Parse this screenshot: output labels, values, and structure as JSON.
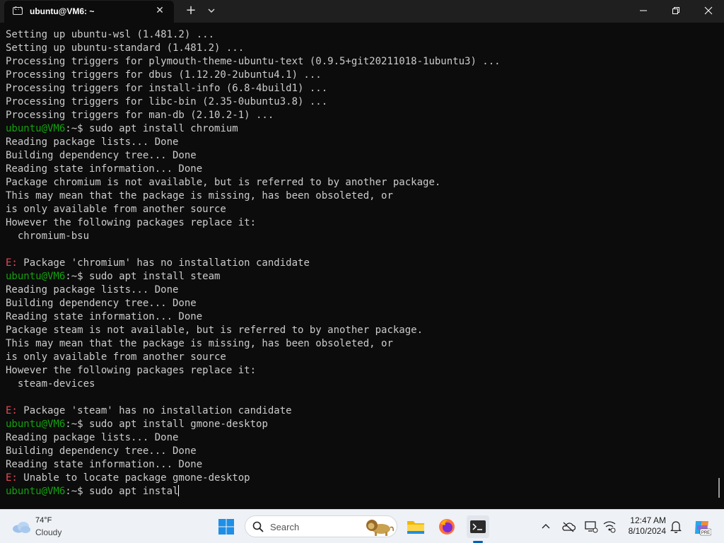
{
  "window": {
    "tab_title": "ubuntu@VM6: ~",
    "tab_icon_glyph": "C:\\"
  },
  "terminal": {
    "lines": [
      [
        {
          "c": "out",
          "t": "Setting up ubuntu-wsl (1.481.2) ..."
        }
      ],
      [
        {
          "c": "out",
          "t": "Setting up ubuntu-standard (1.481.2) ..."
        }
      ],
      [
        {
          "c": "out",
          "t": "Processing triggers for plymouth-theme-ubuntu-text (0.9.5+git20211018-1ubuntu3) ..."
        }
      ],
      [
        {
          "c": "out",
          "t": "Processing triggers for dbus (1.12.20-2ubuntu4.1) ..."
        }
      ],
      [
        {
          "c": "out",
          "t": "Processing triggers for install-info (6.8-4build1) ..."
        }
      ],
      [
        {
          "c": "out",
          "t": "Processing triggers for libc-bin (2.35-0ubuntu3.8) ..."
        }
      ],
      [
        {
          "c": "out",
          "t": "Processing triggers for man-db (2.10.2-1) ..."
        }
      ],
      [
        {
          "c": "user",
          "t": "ubuntu@VM6"
        },
        {
          "c": "out",
          "t": ":~$ sudo apt install chromium"
        }
      ],
      [
        {
          "c": "out",
          "t": "Reading package lists... Done"
        }
      ],
      [
        {
          "c": "out",
          "t": "Building dependency tree... Done"
        }
      ],
      [
        {
          "c": "out",
          "t": "Reading state information... Done"
        }
      ],
      [
        {
          "c": "out",
          "t": "Package chromium is not available, but is referred to by another package."
        }
      ],
      [
        {
          "c": "out",
          "t": "This may mean that the package is missing, has been obsoleted, or"
        }
      ],
      [
        {
          "c": "out",
          "t": "is only available from another source"
        }
      ],
      [
        {
          "c": "out",
          "t": "However the following packages replace it:"
        }
      ],
      [
        {
          "c": "out",
          "t": "  chromium-bsu"
        }
      ],
      [
        {
          "c": "out",
          "t": ""
        }
      ],
      [
        {
          "c": "err",
          "t": "E:"
        },
        {
          "c": "out",
          "t": " Package 'chromium' has no installation candidate"
        }
      ],
      [
        {
          "c": "user",
          "t": "ubuntu@VM6"
        },
        {
          "c": "out",
          "t": ":~$ sudo apt install steam"
        }
      ],
      [
        {
          "c": "out",
          "t": "Reading package lists... Done"
        }
      ],
      [
        {
          "c": "out",
          "t": "Building dependency tree... Done"
        }
      ],
      [
        {
          "c": "out",
          "t": "Reading state information... Done"
        }
      ],
      [
        {
          "c": "out",
          "t": "Package steam is not available, but is referred to by another package."
        }
      ],
      [
        {
          "c": "out",
          "t": "This may mean that the package is missing, has been obsoleted, or"
        }
      ],
      [
        {
          "c": "out",
          "t": "is only available from another source"
        }
      ],
      [
        {
          "c": "out",
          "t": "However the following packages replace it:"
        }
      ],
      [
        {
          "c": "out",
          "t": "  steam-devices"
        }
      ],
      [
        {
          "c": "out",
          "t": ""
        }
      ],
      [
        {
          "c": "err",
          "t": "E:"
        },
        {
          "c": "out",
          "t": " Package 'steam' has no installation candidate"
        }
      ],
      [
        {
          "c": "user",
          "t": "ubuntu@VM6"
        },
        {
          "c": "out",
          "t": ":~$ sudo apt install gmone-desktop"
        }
      ],
      [
        {
          "c": "out",
          "t": "Reading package lists... Done"
        }
      ],
      [
        {
          "c": "out",
          "t": "Building dependency tree... Done"
        }
      ],
      [
        {
          "c": "out",
          "t": "Reading state information... Done"
        }
      ],
      [
        {
          "c": "err",
          "t": "E:"
        },
        {
          "c": "out",
          "t": " Unable to locate package gmone-desktop"
        }
      ],
      [
        {
          "c": "user",
          "t": "ubuntu@VM6"
        },
        {
          "c": "out",
          "t": ":~$ sudo apt instal"
        }
      ]
    ]
  },
  "taskbar": {
    "weather": {
      "temp": "74°F",
      "desc": "Cloudy",
      "icon": "cloud-icon"
    },
    "search_label": "Search",
    "apps": [
      "file-explorer-icon",
      "firefox-icon",
      "terminal-icon"
    ],
    "clock": {
      "time": "12:47 AM",
      "date": "8/10/2024"
    },
    "copilot_badge": "PRE"
  },
  "colors": {
    "terminal_bg": "#0c0c0c",
    "terminal_fg": "#cccccc",
    "prompt_user": "#13a10e",
    "error": "#e74856",
    "titlebar_bg": "#1f1f1f",
    "taskbar_bg": "#eef1f6",
    "accent": "#005fb8"
  }
}
